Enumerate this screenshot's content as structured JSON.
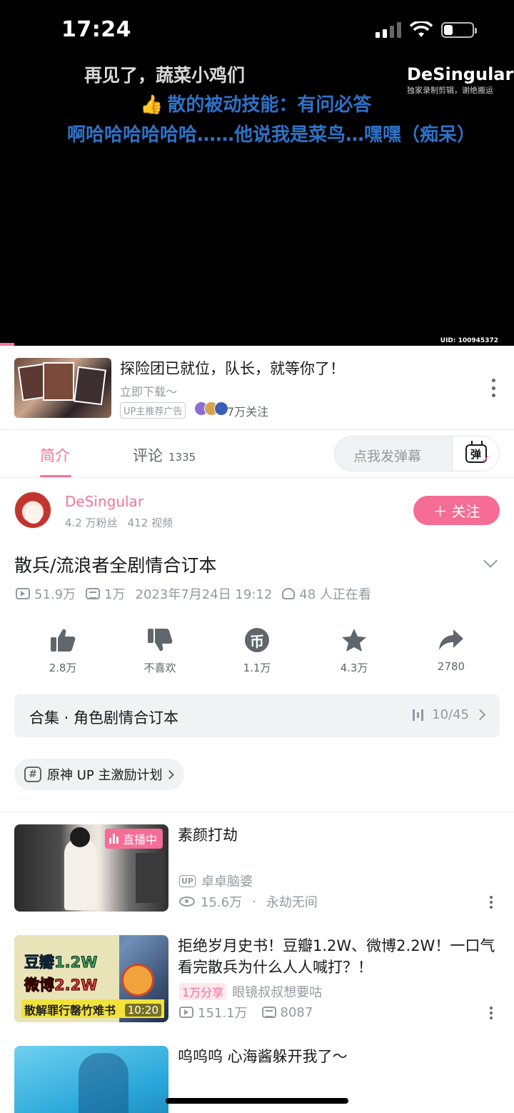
{
  "status_bar": {
    "time": "17:24"
  },
  "player": {
    "subtitles": [
      "再见了，蔬菜小鸡们",
      "散的被动技能：有问必答",
      "啊哈哈哈哈哈哈……他说我是菜鸟…嘿嘿（痴呆）"
    ],
    "watermark_name": "DeSingular",
    "watermark_sub": "独家录制剪辑，谢绝搬运",
    "uid": "UID: 100945372"
  },
  "ad": {
    "title": "探险团已就位，队长，就等你了！",
    "subtitle": "立即下载～",
    "tag": "UP主推荐广告",
    "followers": "7万关注"
  },
  "tabs": {
    "intro": "简介",
    "comments": "评论",
    "comment_count": "1335",
    "danmaku_placeholder": "点我发弹幕",
    "danmaku_icon_char": "弹"
  },
  "uploader": {
    "name": "DeSingular",
    "fans": "4.2 万粉丝",
    "videos": "412 视频",
    "follow_label": "关注"
  },
  "video": {
    "title": "散兵/流浪者全剧情合订本",
    "views": "51.9万",
    "danmaku": "1万",
    "date": "2023年7月24日 19:12",
    "watching": "48 人正在看"
  },
  "actions": [
    {
      "name": "like",
      "label": "2.8万"
    },
    {
      "name": "dislike",
      "label": "不喜欢"
    },
    {
      "name": "coin",
      "label": "1.1万"
    },
    {
      "name": "favorite",
      "label": "4.3万"
    },
    {
      "name": "share",
      "label": "2780"
    }
  ],
  "collection": {
    "title": "合集 · 角色剧情合订本",
    "progress": "10/45"
  },
  "topic": {
    "label": "原神 UP 主激励计划"
  },
  "recommendations": [
    {
      "title": "素颜打劫",
      "badge": "直播中",
      "uploader": "卓卓脑婆",
      "views": "15.6万",
      "area": "永劫无间"
    },
    {
      "title": "拒绝岁月史书！豆瓣1.2W、微博2.2W！一口气看完散兵为什么人人喊打？！",
      "duration": "10:20",
      "tag": "1万分享",
      "uploader": "眼镜叔叔想要咕",
      "views": "151.1万",
      "danmaku": "8087",
      "thumb_text": [
        "豆瓣1.2W",
        "微博2.2W",
        "散解罪行罄竹难书"
      ]
    },
    {
      "title": "呜呜呜  心海酱躲开我了～"
    }
  ],
  "colors": {
    "accent": "#fb7299",
    "player_bg": "#000000",
    "subtitle_blue": "#2f72c7"
  }
}
